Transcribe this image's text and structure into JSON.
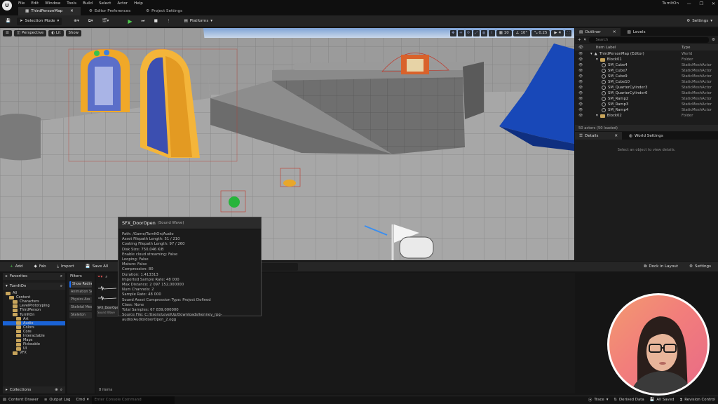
{
  "menubar": {
    "logo": "U",
    "items": [
      "File",
      "Edit",
      "Window",
      "Tools",
      "Build",
      "Select",
      "Actor",
      "Help"
    ],
    "project_name": "TurnItOn",
    "window_controls": [
      "—",
      "❐",
      "✕"
    ]
  },
  "tabs": [
    {
      "label": "ThirdPersonMap",
      "active": true
    },
    {
      "label": "Editor Preferences",
      "active": false
    },
    {
      "label": "Project Settings",
      "active": false
    }
  ],
  "toolbar": {
    "selection_mode": "Selection Mode",
    "platforms": "Platforms",
    "settings": "Settings"
  },
  "viewport": {
    "perspective": "Perspective",
    "lit": "Lit",
    "show": "Show",
    "snap_grid": "10",
    "snap_angle": "10°",
    "snap_scale": "0.25",
    "camera_speed": "4"
  },
  "tooltip": {
    "title": "SFX_DoorOpen",
    "type": "(Sound Wave)",
    "lines": [
      "Path: /Game/TurnItOn/Audio",
      "Asset Filepath Length: 51 / 210",
      "Cooking Filepath Length: 97 / 260",
      "Disk Size: 750,046 KiB",
      "Enable cloud streaming: False",
      "Looping: False",
      "Mature: False",
      "Compression: 80",
      "Duration: 1.413313",
      "Imported Sample Rate: 48 000",
      "Max Distance: 2 097 152,000000",
      "Num Channels: 2",
      "Sample Rate: 48 000",
      "Sound Asset Compression Type: Project Defined",
      "Class: None",
      "Total Samples: 67 839,000000",
      "Source File: C:/Users/LevelUp/Downloads/kenney_rpg-audio/Audio/doorOpen_2.ogg"
    ]
  },
  "outliner": {
    "tab_label": "Outliner",
    "levels_label": "Levels",
    "search_placeholder": "Search",
    "col_label": "Item Label",
    "col_type": "Type",
    "rows": [
      {
        "name": "ThirdPersonMap (Editor)",
        "type": "World",
        "indent": 0,
        "kind": "world"
      },
      {
        "name": "Block01",
        "type": "Folder",
        "indent": 1,
        "kind": "folder"
      },
      {
        "name": "SM_Cube4",
        "type": "StaticMeshActor",
        "indent": 2,
        "kind": "mesh"
      },
      {
        "name": "SM_Cube7",
        "type": "StaticMeshActor",
        "indent": 2,
        "kind": "mesh"
      },
      {
        "name": "SM_Cube9",
        "type": "StaticMeshActor",
        "indent": 2,
        "kind": "mesh"
      },
      {
        "name": "SM_Cube10",
        "type": "StaticMeshActor",
        "indent": 2,
        "kind": "mesh"
      },
      {
        "name": "SM_QuarterCylinder3",
        "type": "StaticMeshActor",
        "indent": 2,
        "kind": "mesh"
      },
      {
        "name": "SM_QuarterCylinder6",
        "type": "StaticMeshActor",
        "indent": 2,
        "kind": "mesh"
      },
      {
        "name": "SM_Ramp2",
        "type": "StaticMeshActor",
        "indent": 2,
        "kind": "mesh"
      },
      {
        "name": "SM_Ramp3",
        "type": "StaticMeshActor",
        "indent": 2,
        "kind": "mesh"
      },
      {
        "name": "SM_Ramp4",
        "type": "StaticMeshActor",
        "indent": 2,
        "kind": "mesh"
      },
      {
        "name": "Block02",
        "type": "Folder",
        "indent": 1,
        "kind": "folder"
      }
    ],
    "actor_count": "50 actors (50 loaded)"
  },
  "details": {
    "tab_label": "Details",
    "world_settings": "World Settings",
    "empty_text": "Select an object to view details."
  },
  "content_browser": {
    "add": "Add",
    "fab": "Fab",
    "import": "Import",
    "save_all": "Save All",
    "all": "All",
    "dock_in_layout": "Dock in Layout",
    "settings": "Settings",
    "favorites": "Favorites",
    "project": "TurnItOn",
    "collections": "Collections",
    "filters": "Filters",
    "filter_buttons": [
      "Show Redire",
      "Animation Se",
      "Physics Ass",
      "Skeletal Mes",
      "Skeleton"
    ],
    "tree": [
      {
        "name": "All",
        "indent": 0
      },
      {
        "name": "Content",
        "indent": 1
      },
      {
        "name": "Characters",
        "indent": 2
      },
      {
        "name": "LevelPrototyping",
        "indent": 2
      },
      {
        "name": "ThirdPerson",
        "indent": 2
      },
      {
        "name": "TurnItOn",
        "indent": 2
      },
      {
        "name": "Art",
        "indent": 3
      },
      {
        "name": "Audio",
        "indent": 3,
        "selected": true
      },
      {
        "name": "Colors",
        "indent": 3
      },
      {
        "name": "Core",
        "indent": 3
      },
      {
        "name": "Interactable",
        "indent": 3
      },
      {
        "name": "Maps",
        "indent": 3
      },
      {
        "name": "Pickeable",
        "indent": 3
      },
      {
        "name": "UI",
        "indent": 3
      },
      {
        "name": "VFX",
        "indent": 2
      }
    ],
    "asset_name": "SFX_DoorOpen",
    "asset_type": "Sound Wave",
    "item_count": "8 items"
  },
  "statusbar": {
    "content_drawer": "Content Drawer",
    "output_log": "Output Log",
    "cmd": "Cmd",
    "console_placeholder": "Enter Console Command",
    "trace": "Trace",
    "derived_data": "Derived Data",
    "all_saved": "All Saved",
    "revision_control": "Revision Control"
  }
}
